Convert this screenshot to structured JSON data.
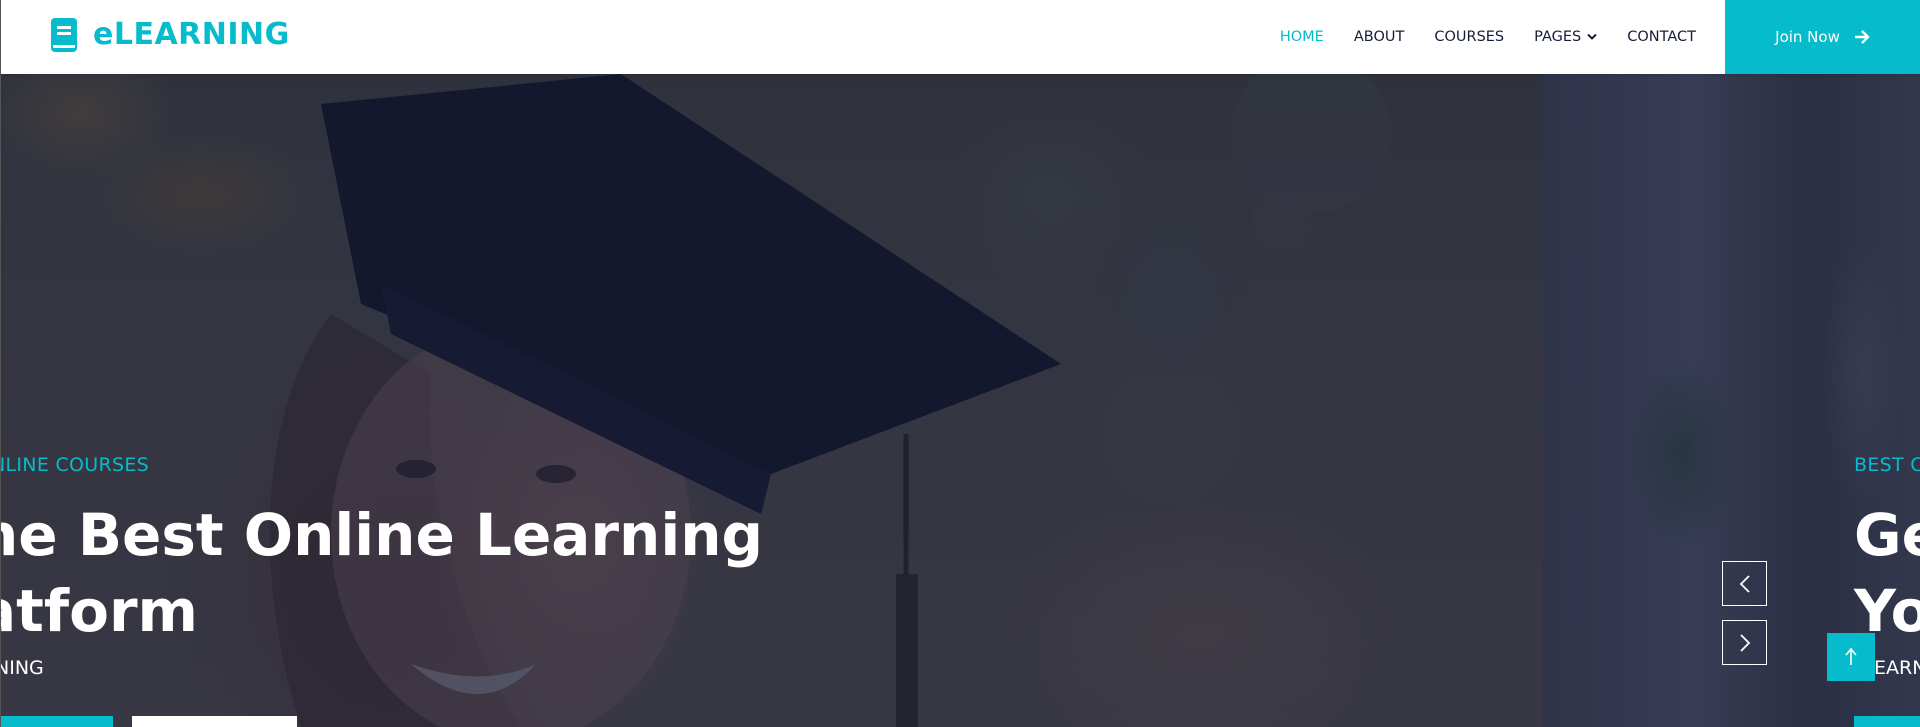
{
  "brand": {
    "name": "eLEARNING",
    "icon": "book-icon"
  },
  "nav": {
    "items": [
      {
        "label": "HOME",
        "active": true
      },
      {
        "label": "ABOUT",
        "active": false
      },
      {
        "label": "COURSES",
        "active": false
      },
      {
        "label": "PAGES",
        "active": false,
        "dropdown": true
      },
      {
        "label": "CONTACT",
        "active": false
      }
    ],
    "join_label": "Join Now",
    "join_icon": "arrow-right-icon"
  },
  "slides": [
    {
      "tagline": "NLINE COURSES",
      "headline_line1": "he Best Online Learning",
      "headline_line2": "atform",
      "subtext": "NING"
    },
    {
      "tagline": "BEST C",
      "headline_line1": "Ge",
      "headline_line2": "Yo",
      "subtext": "EARN"
    }
  ],
  "carousel": {
    "prev_icon": "chevron-left-icon",
    "next_icon": "chevron-right-icon"
  },
  "back_to_top_icon": "arrow-up-icon",
  "colors": {
    "primary": "#06BBCC",
    "dark": "#181d38",
    "white": "#ffffff"
  }
}
